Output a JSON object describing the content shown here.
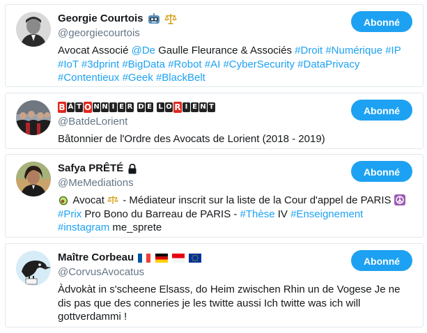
{
  "follow_button_label": "Abonné",
  "accounts": [
    {
      "name": "Georgie Courtois",
      "handle": "@georgiecourtois",
      "name_emoji": [
        "robot-face-icon",
        "balance-scale-icon"
      ],
      "bio_segments": [
        {
          "t": "Avocat Associé ",
          "tag": false
        },
        {
          "t": "@De",
          "tag": true
        },
        {
          "t": " Gaulle Fleurance & Associés ",
          "tag": false
        },
        {
          "t": "#Droit",
          "tag": true
        },
        {
          "t": " ",
          "tag": false
        },
        {
          "t": "#Numérique",
          "tag": true
        },
        {
          "t": " ",
          "tag": false
        },
        {
          "t": "#IP",
          "tag": true
        },
        {
          "t": " ",
          "tag": false
        },
        {
          "t": "#IoT",
          "tag": true
        },
        {
          "t": " ",
          "tag": false
        },
        {
          "t": "#3dprint",
          "tag": true
        },
        {
          "t": " ",
          "tag": false
        },
        {
          "t": "#BigData",
          "tag": true
        },
        {
          "t": " ",
          "tag": false
        },
        {
          "t": "#Robot",
          "tag": true
        },
        {
          "t": " ",
          "tag": false
        },
        {
          "t": "#AI",
          "tag": true
        },
        {
          "t": " ",
          "tag": false
        },
        {
          "t": "#CyberSecurity",
          "tag": true
        },
        {
          "t": " ",
          "tag": false
        },
        {
          "t": "#DataPrivacy",
          "tag": true
        },
        {
          "t": " ",
          "tag": false
        },
        {
          "t": "#Contentieux",
          "tag": true
        },
        {
          "t": " ",
          "tag": false
        },
        {
          "t": "#Geek",
          "tag": true
        },
        {
          "t": " ",
          "tag": false
        },
        {
          "t": "#BlackBelt",
          "tag": true
        }
      ]
    },
    {
      "name_letters": "BÂTONNIER DE LORIENT",
      "handle": "@BatdeLorient",
      "bio_segments": [
        {
          "t": "Bâtonnier de l'Ordre des Avocats de Lorient (2018 - 2019)",
          "tag": false
        }
      ]
    },
    {
      "name": "Safya PRÊTÉ",
      "handle": "@MeMediations",
      "name_emoji": [
        "lock-icon"
      ],
      "bio_segments": [
        {
          "t": " Avocat ",
          "tag": false
        },
        {
          "t": " - Médiateur inscrit sur la liste de la Cour d'appel de PARIS ",
          "tag": false
        },
        {
          "t": "#Prix",
          "tag": true
        },
        {
          "t": " Pro Bono du Barreau de PARIS - ",
          "tag": false
        },
        {
          "t": "#Thèse",
          "tag": true
        },
        {
          "t": " IV ",
          "tag": false
        },
        {
          "t": "#Enseignement",
          "tag": true
        },
        {
          "t": " ",
          "tag": false
        },
        {
          "t": "#instagram",
          "tag": true
        },
        {
          "t": " me_sprete",
          "tag": false
        }
      ]
    },
    {
      "name": "Maître Corbeau",
      "handle": "@CorvusAvocatus",
      "name_emoji": [
        "france-flag-icon",
        "germany-flag-icon",
        "indonesia-flag-icon",
        "eu-flag-icon"
      ],
      "bio_segments": [
        {
          "t": "Àdvokàt in s'scheene Elsass, do Heim zwischen Rhin un de Vogese Je ne dis pas que des conneries je les twitte aussi Ich twitte was ich will gottverdammi !",
          "tag": false
        }
      ]
    }
  ],
  "colors": {
    "link": "#1da1f2",
    "button_bg": "#1da1f2",
    "handle": "#657786",
    "border": "#e1e8ed"
  }
}
